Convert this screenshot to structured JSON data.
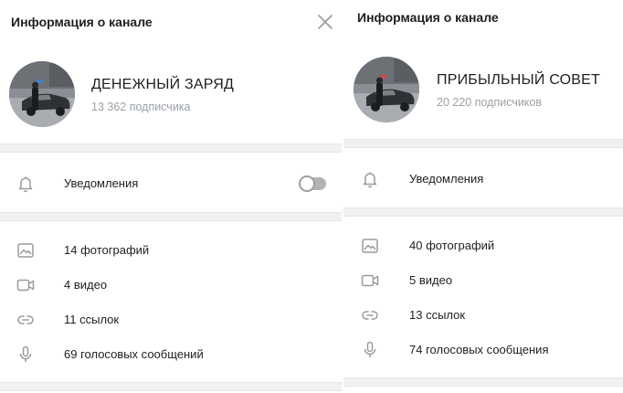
{
  "panels": [
    {
      "title": "Информация о канале",
      "channel_name": "ДЕНЕЖНЫЙ ЗАРЯД",
      "subscribers": "13 362 подписчика",
      "notifications_label": "Уведомления",
      "notifications_enabled": false,
      "media": {
        "photos": "14 фотографий",
        "videos": "4 видео",
        "links": "11 ссылок",
        "voice": "69 голосовых сообщений"
      }
    },
    {
      "title": "Информация о канале",
      "channel_name": "ПРИБЫЛЬНЫЙ СОВЕТ",
      "subscribers": "20 220 подписчиков",
      "notifications_label": "Уведомления",
      "media": {
        "photos": "40 фотографий",
        "videos": "5 видео",
        "links": "13 ссылок",
        "voice": "74 голосовых сообщения"
      }
    }
  ],
  "icons": {
    "close": "close-icon",
    "bell": "bell-icon",
    "photo": "image-icon",
    "video": "video-camera-icon",
    "link": "link-icon",
    "voice": "microphone-icon"
  },
  "colors": {
    "icon": "#9a9a9a",
    "separator": "#f1f1f1",
    "secondary_text": "#9aa0a6",
    "toggle_off": "#b3b3b3"
  }
}
